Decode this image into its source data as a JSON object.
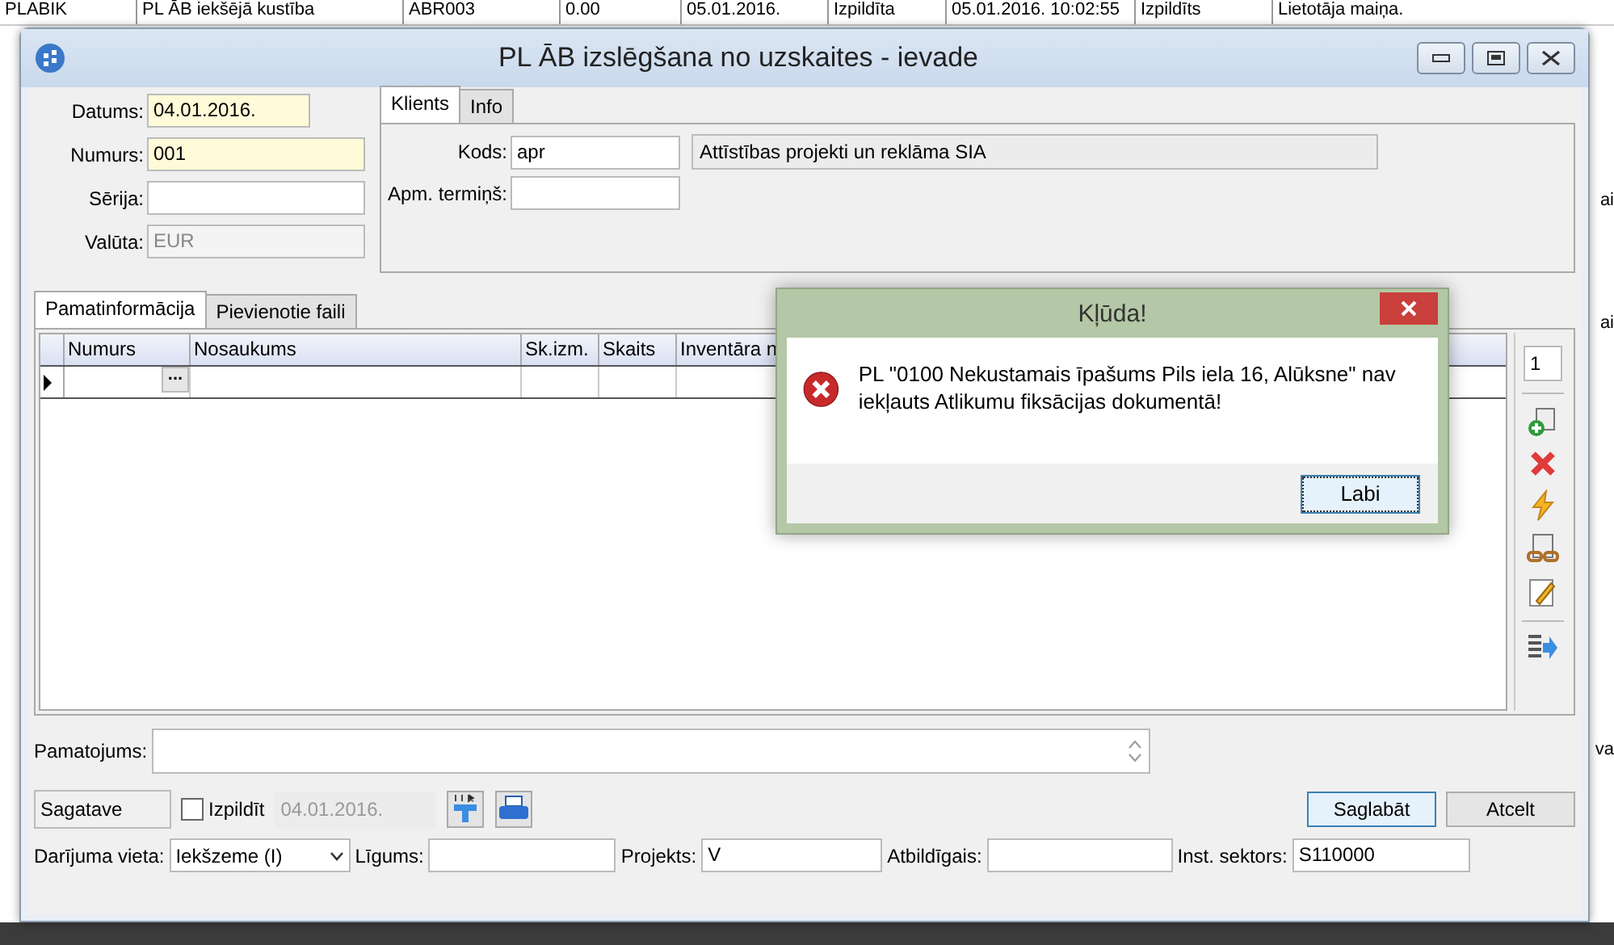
{
  "background_table": {
    "row": [
      "PLABIK",
      "PL ĀB iekšējā kustība",
      "ABR003",
      "0.00",
      "05.01.2016.",
      "Izpildīta",
      "05.01.2016. 10:02:55",
      "Izpildīts",
      "Lietotāja maiņa."
    ],
    "fragments": [
      "ai",
      "ai",
      "va"
    ]
  },
  "window": {
    "title": "PL ĀB izslēgšana no uzskaites - ievade"
  },
  "header_fields": [
    {
      "label": "Datums:",
      "value": "04.01.2016.",
      "kind": "date",
      "required": true
    },
    {
      "label": "Numurs:",
      "value": "001",
      "kind": "text",
      "required": true
    },
    {
      "label": "Sērija:",
      "kind": "text",
      "required": false
    },
    {
      "label": "Valūta:",
      "value": "EUR",
      "kind": "disabled",
      "required": false
    }
  ],
  "client_tabs": [
    {
      "label": "Klients",
      "selected": true
    },
    {
      "label": "Info",
      "selected": false
    }
  ],
  "client_fields": [
    {
      "label": "Kods:",
      "value": "apr",
      "name": "Attīstības projekti un reklāma SIA"
    },
    {
      "label": "Apm. termiņš:"
    }
  ],
  "detail_tabs": [
    {
      "label": "Pamatinformācija",
      "selected": true
    },
    {
      "label": "Pievienotie faili",
      "selected": false
    }
  ],
  "grid": {
    "columns": [
      "Numurs",
      "Nosaukums",
      "Sk.izm.",
      "Skaits",
      "Inventāra n"
    ],
    "row_button": "..."
  },
  "toolbar": {
    "counter": "1"
  },
  "pamatojums": {
    "label": "Pamatojums:"
  },
  "status": {
    "state": "Sagatave",
    "checkbox": {
      "label": "Izpildīt",
      "checked": false
    },
    "date": "04.01.2016."
  },
  "buttons": [
    {
      "label": "Saglabāt",
      "default": true
    },
    {
      "label": "Atcelt",
      "default": false
    }
  ],
  "bottom_fields": [
    {
      "label": "Darījuma vieta:",
      "value": "Iekšzeme (I)",
      "kind": "combo"
    },
    {
      "label": "Līgums:",
      "kind": "text"
    },
    {
      "label": "Projekts:",
      "value": "V",
      "kind": "text"
    },
    {
      "label": "Atbildīgais:",
      "kind": "text"
    },
    {
      "label": "Inst. sektors:",
      "value": "S110000",
      "kind": "text"
    }
  ],
  "dialog": {
    "title": "Kļūda!",
    "message": "PL \"0100 Nekustamais īpašums Pils iela 16, Alūksne\" nav iekļauts Atlikumu fiksācijas dokumentā!",
    "button": "Labi"
  }
}
